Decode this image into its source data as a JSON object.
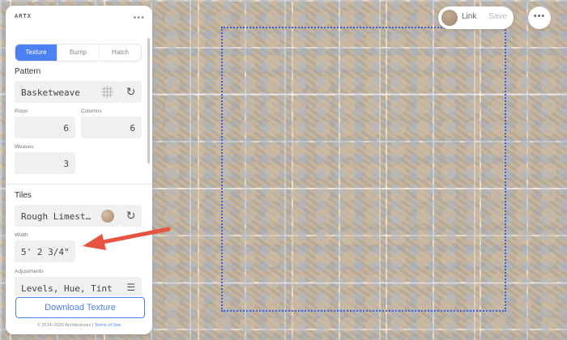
{
  "app": {
    "logo": "ARTX"
  },
  "colors": {
    "accent": "#4d80f5",
    "arrow": "#e8533f",
    "repeat_outline": "#3a5fe0"
  },
  "panel": {
    "tabs": [
      {
        "label": "Texture",
        "active": true
      },
      {
        "label": "Bump",
        "active": false
      },
      {
        "label": "Hatch",
        "active": false
      }
    ],
    "pattern": {
      "section_title": "Pattern",
      "value": "Basketweave",
      "rows_label": "Rows",
      "rows_value": "6",
      "columns_label": "Columns",
      "columns_value": "6",
      "weaves_label": "Weaves",
      "weaves_value": "3"
    },
    "tiles": {
      "section_title": "Tiles",
      "material": "Rough Limest…",
      "width_label": "Width",
      "width_value": "5' 2 3/4\"",
      "adjustments_label": "Adjustments",
      "adjustments_value": "Levels, Hue, Tint"
    },
    "download_label": "Download Texture",
    "footer_text": "© 2014–2020 Architextures | ",
    "footer_link": "Terms of Use"
  },
  "topbar": {
    "link_label": "Link",
    "save_label": "Save"
  },
  "icons": {
    "panel_menu": "more-dots-icon",
    "pattern_thumb": "grid-pattern-icon",
    "refresh": "refresh-icon",
    "swatch": "material-swatch-icon",
    "adjust": "sliders-icon",
    "top_menu": "more-dots-icon"
  }
}
